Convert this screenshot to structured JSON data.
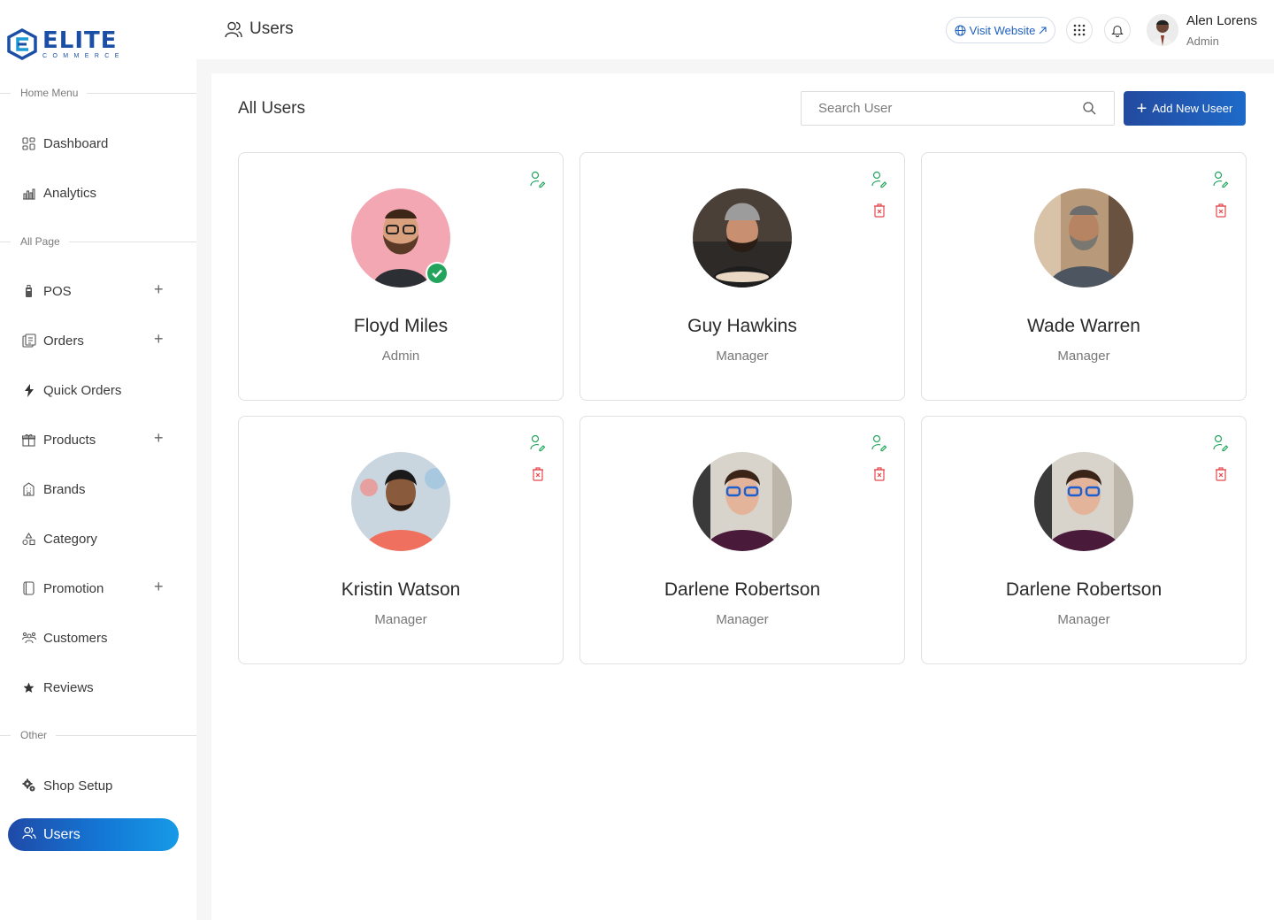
{
  "brand": {
    "name": "ELITE",
    "tagline": "COMMERCE",
    "accent": "#1b4fa5"
  },
  "sidebar": {
    "sections": [
      {
        "label": "Home Menu"
      },
      {
        "label": "All Page"
      },
      {
        "label": "Other"
      }
    ],
    "items": [
      {
        "label": "Dashboard",
        "icon": "dashboard-icon",
        "expandable": false
      },
      {
        "label": "Analytics",
        "icon": "analytics-icon",
        "expandable": false
      },
      {
        "label": "POS",
        "icon": "pos-icon",
        "expandable": true
      },
      {
        "label": "Orders",
        "icon": "orders-icon",
        "expandable": true
      },
      {
        "label": "Quick Orders",
        "icon": "lightning-icon",
        "expandable": false
      },
      {
        "label": "Products",
        "icon": "gift-icon",
        "expandable": true
      },
      {
        "label": "Brands",
        "icon": "building-icon",
        "expandable": false
      },
      {
        "label": "Category",
        "icon": "shapes-icon",
        "expandable": false
      },
      {
        "label": "Promotion",
        "icon": "promotion-icon",
        "expandable": true
      },
      {
        "label": "Customers",
        "icon": "customers-icon",
        "expandable": false
      },
      {
        "label": "Reviews",
        "icon": "star-icon",
        "expandable": false
      },
      {
        "label": "Shop Setup",
        "icon": "gears-icon",
        "expandable": false
      },
      {
        "label": "Users",
        "icon": "users-icon",
        "active": true
      }
    ]
  },
  "header": {
    "title": "Users",
    "visit_label": "Visit Website",
    "user": {
      "name": "Alen Lorens",
      "role": "Admin"
    }
  },
  "main": {
    "title": "All Users",
    "search_placeholder": "Search User",
    "add_label": "Add New Useer",
    "users": [
      {
        "name": "Floyd Miles",
        "role": "Admin",
        "verified": true,
        "deletable": false
      },
      {
        "name": "Guy Hawkins",
        "role": "Manager",
        "verified": false,
        "deletable": true
      },
      {
        "name": "Wade Warren",
        "role": "Manager",
        "verified": false,
        "deletable": true
      },
      {
        "name": "Kristin Watson",
        "role": "Manager",
        "verified": false,
        "deletable": true
      },
      {
        "name": "Darlene Robertson",
        "role": "Manager",
        "verified": false,
        "deletable": true
      },
      {
        "name": "Darlene Robertson",
        "role": "Manager",
        "verified": false,
        "deletable": true
      }
    ]
  },
  "colors": {
    "primary": "#1f4aa8",
    "success": "#22a45d",
    "danger": "#e5484d"
  }
}
